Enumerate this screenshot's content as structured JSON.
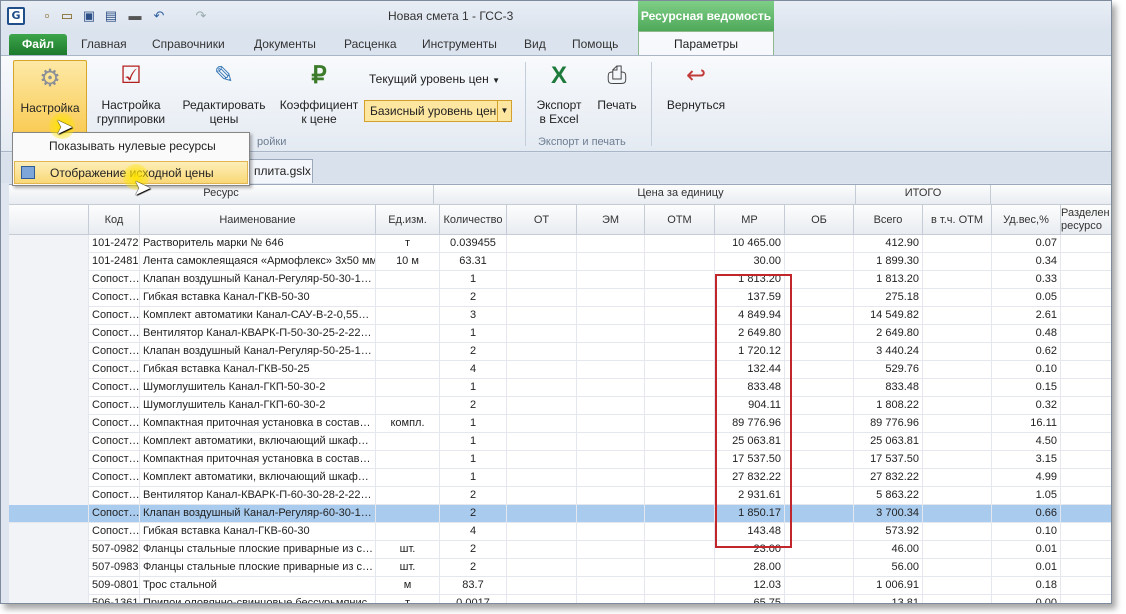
{
  "window": {
    "title": "Новая смета 1 - ГСС-3",
    "context_tab": "Ресурсная ведомость"
  },
  "ribbon_tabs": {
    "file": "Файл",
    "items": [
      "Главная",
      "Справочники",
      "Документы",
      "Расценка",
      "Инструменты",
      "Вид",
      "Помощь"
    ],
    "active": "Параметры"
  },
  "ribbon": {
    "settings": "Настройка",
    "grouping": [
      "Настройка",
      "группировки"
    ],
    "edit_prices": [
      "Редактировать",
      "цены"
    ],
    "coefficient": [
      "Коэффициент",
      "к цене"
    ],
    "level_current": "Текущий уровень цен",
    "level_basis": "Базисный уровень цен",
    "group_settings": "ройки",
    "export_excel": [
      "Экспорт",
      "в Excel"
    ],
    "print": "Печать",
    "group_export": "Экспорт и печать",
    "back": "Вернуться"
  },
  "menu": {
    "show_zero": "Показывать нулевые ресурсы",
    "show_price": "Отображение исходной цены"
  },
  "doc_tab": "плита.gslx",
  "table": {
    "group_headers": {
      "resource": "Ресурс",
      "unit_price": "Цена за единицу",
      "total": "ИТОГО"
    },
    "columns": [
      "Код",
      "Наименование",
      "Ед.изм.",
      "Количество",
      "ОТ",
      "ЭМ",
      "ОТМ",
      "МР",
      "ОБ",
      "Всего",
      "в т.ч. ОТМ",
      "Уд.вес,%",
      "Разделен ресурсо"
    ],
    "rows": [
      [
        "101-2472",
        "Растворитель марки № 646",
        "т",
        "0.039455",
        "10 465.00",
        "412.90",
        "0.07"
      ],
      [
        "101-2481",
        "Лента самоклеящаяся «Армофлекс» 3х50 мм",
        "10 м",
        "63.31",
        "30.00",
        "1 899.30",
        "0.34"
      ],
      [
        "Сопост…",
        "Клапан воздушный Канал-Регуляр-50-30-1…",
        "",
        "1",
        "1 813.20",
        "1 813.20",
        "0.33"
      ],
      [
        "Сопост…",
        "Гибкая вставка Канал-ГКВ-50-30",
        "",
        "2",
        "137.59",
        "275.18",
        "0.05"
      ],
      [
        "Сопост…",
        "Комплект автоматики Канал-САУ-В-2-0,55…",
        "",
        "3",
        "4 849.94",
        "14 549.82",
        "2.61"
      ],
      [
        "Сопост…",
        "Вентилятор Канал-КВАРК-П-50-30-25-2-22…",
        "",
        "1",
        "2 649.80",
        "2 649.80",
        "0.48"
      ],
      [
        "Сопост…",
        "Клапан воздушный Канал-Регуляр-50-25-1…",
        "",
        "2",
        "1 720.12",
        "3 440.24",
        "0.62"
      ],
      [
        "Сопост…",
        "Гибкая вставка Канал-ГКВ-50-25",
        "",
        "4",
        "132.44",
        "529.76",
        "0.10"
      ],
      [
        "Сопост…",
        "Шумоглушитель Канал-ГКП-50-30-2",
        "",
        "1",
        "833.48",
        "833.48",
        "0.15"
      ],
      [
        "Сопост…",
        "Шумоглушитель Канал-ГКП-60-30-2",
        "",
        "2",
        "904.11",
        "1 808.22",
        "0.32"
      ],
      [
        "Сопост…",
        "Компактная приточная установка в состав…",
        "компл.",
        "1",
        "89 776.96",
        "89 776.96",
        "16.11"
      ],
      [
        "Сопост…",
        "Комплект автоматики, включающий шкаф…",
        "",
        "1",
        "25 063.81",
        "25 063.81",
        "4.50"
      ],
      [
        "Сопост…",
        "Компактная приточная установка в состав…",
        "",
        "1",
        "17 537.50",
        "17 537.50",
        "3.15"
      ],
      [
        "Сопост…",
        "Комплект автоматики, включающий шкаф…",
        "",
        "1",
        "27 832.22",
        "27 832.22",
        "4.99"
      ],
      [
        "Сопост…",
        "Вентилятор Канал-КВАРК-П-60-30-28-2-22…",
        "",
        "2",
        "2 931.61",
        "5 863.22",
        "1.05"
      ],
      [
        "Сопост…",
        "Клапан воздушный Канал-Регуляр-60-30-1…",
        "",
        "2",
        "1 850.17",
        "3 700.34",
        "0.66"
      ],
      [
        "Сопост…",
        "Гибкая вставка Канал-ГКВ-60-30",
        "",
        "4",
        "143.48",
        "573.92",
        "0.10"
      ],
      [
        "507-0982",
        "Фланцы стальные плоские приварные из с…",
        "шт.",
        "2",
        "23.00",
        "46.00",
        "0.01"
      ],
      [
        "507-0983",
        "Фланцы стальные плоские приварные из с…",
        "шт.",
        "2",
        "28.00",
        "56.00",
        "0.01"
      ],
      [
        "509-0801",
        "Трос стальной",
        "м",
        "83.7",
        "12.03",
        "1 006.91",
        "0.18"
      ],
      [
        "506-1361",
        "Припои оловянно-свинцовые бессурьмянис…",
        "т",
        "0.0017",
        "65.75",
        "13.81",
        "0.00"
      ]
    ]
  }
}
